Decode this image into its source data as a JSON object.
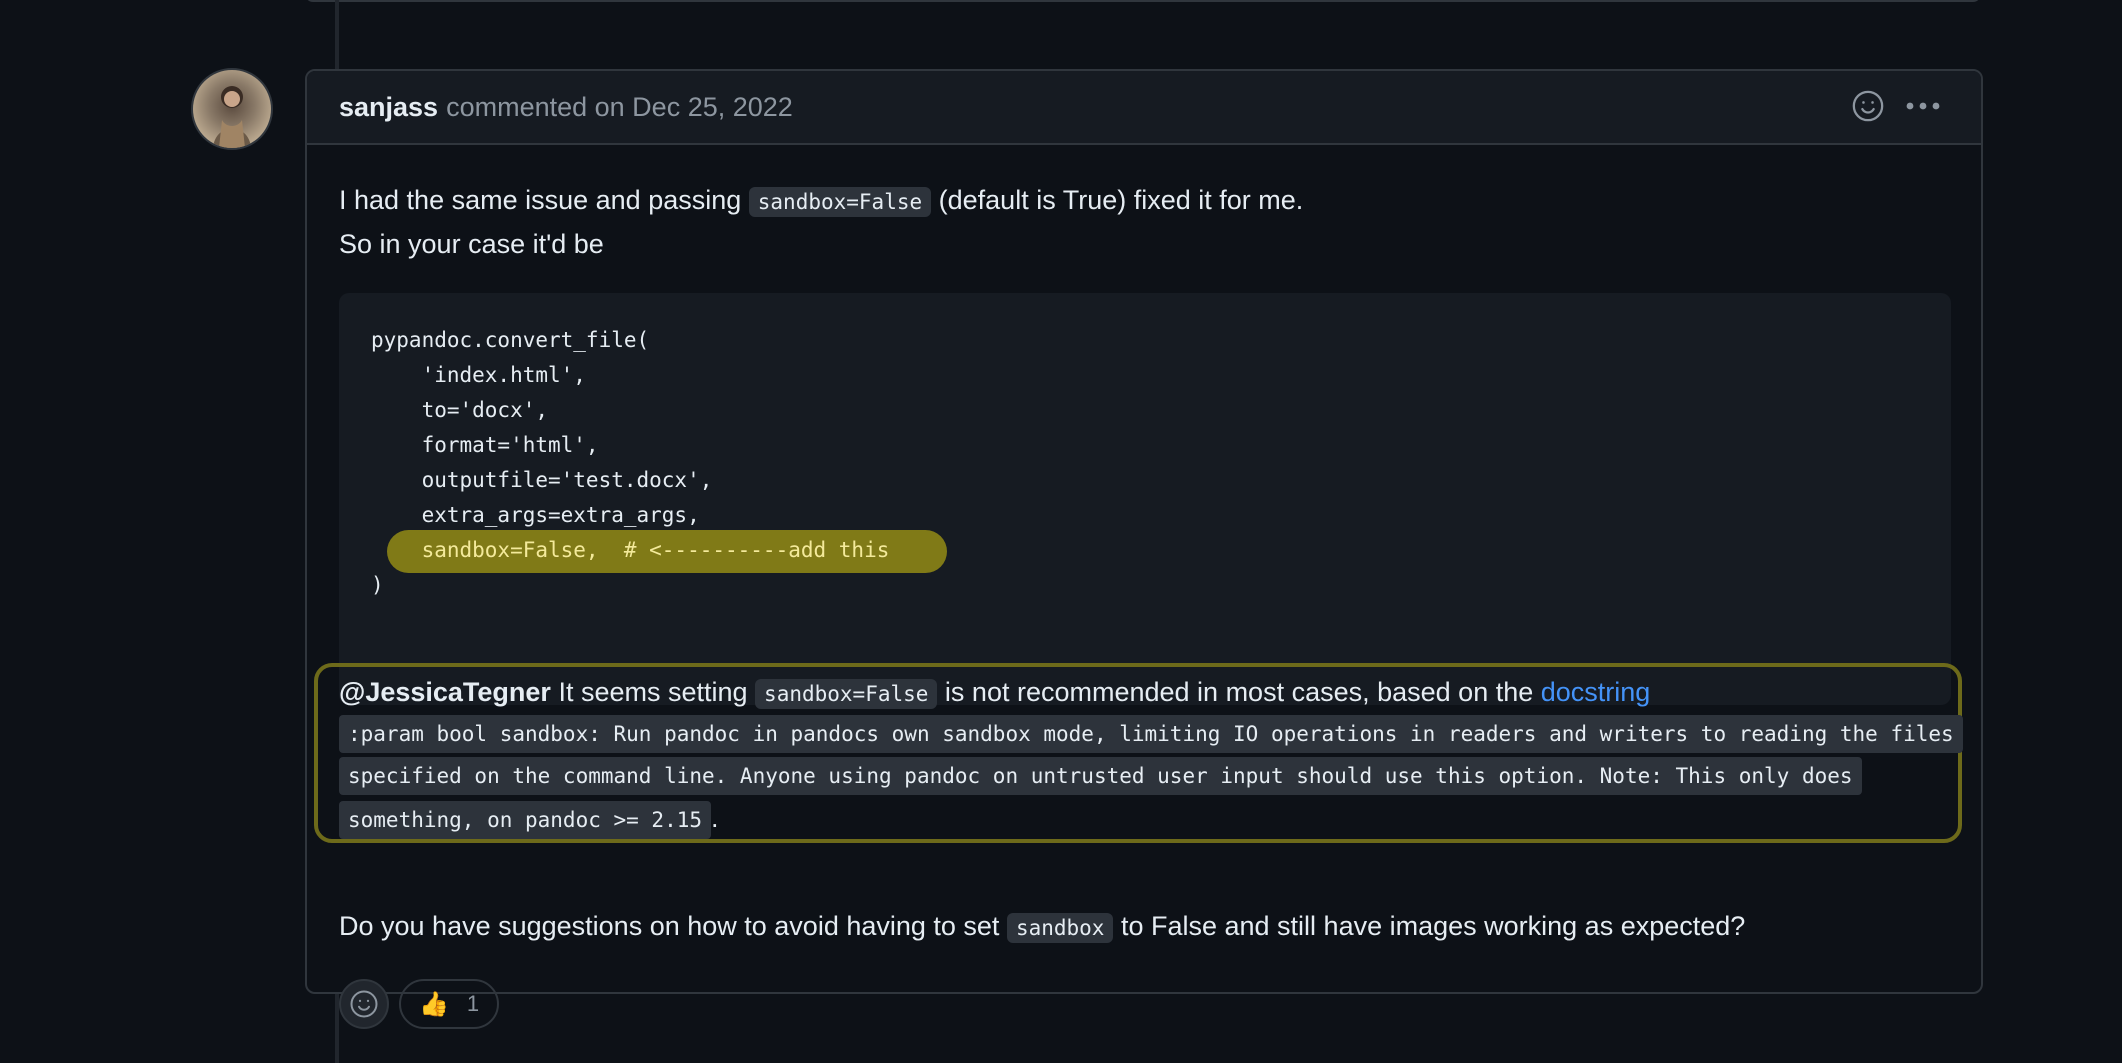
{
  "comment": {
    "author": "sanjass",
    "meta": "commented on Dec 25, 2022",
    "para1_before": "I had the same issue and passing ",
    "para1_code": "sandbox=False",
    "para1_after": " (default is True) fixed it for me.",
    "para1_line2": "So in your case it'd be",
    "code_lines": [
      "pypandoc.convert_file(",
      "    'index.html',",
      "    to='docx',",
      "    format='html',",
      "    outputfile='test.docx',",
      "    extra_args=extra_args,",
      "    sandbox=False,  # <----------add this",
      ")"
    ],
    "para2_mention": "@JessicaTegner",
    "para2_before": " It seems setting ",
    "para2_code": "sandbox=False",
    "para2_after": " is not recommended in most cases, based on the ",
    "para2_link": "docstring",
    "docstring": ":param bool sandbox: Run pandoc in pandocs own sandbox mode, limiting IO operations in readers and writers to reading the files specified on the command line. Anyone using pandoc on untrusted user input should use this option. Note: This only does something, on pandoc >= 2.15",
    "docstring_end": ".",
    "para3_before": "Do you have suggestions on how to avoid having to set ",
    "para3_code": "sandbox",
    "para3_after": " to False and still have images working as expected?",
    "reaction_emoji": "👍",
    "reaction_count": "1"
  },
  "icons": {
    "add_reaction": "smiley-icon",
    "more": "kebab-horizontal-icon"
  },
  "colors": {
    "background": "#0d1117",
    "header_bg": "#161b22",
    "border": "#30363d",
    "link": "#4493f8",
    "highlight": "#807a17",
    "outline": "#6d6a1a"
  }
}
